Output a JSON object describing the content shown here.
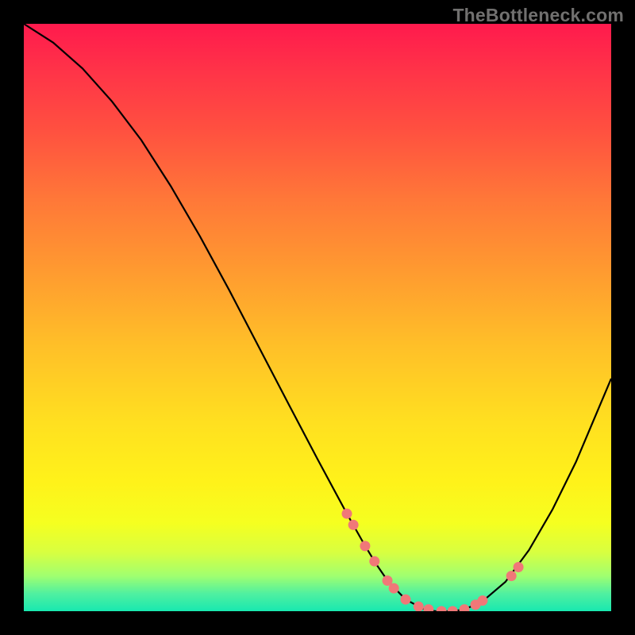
{
  "watermark": "TheBottleneck.com",
  "chart_data": {
    "type": "line",
    "title": "",
    "xlabel": "",
    "ylabel": "",
    "xlim": [
      0,
      100
    ],
    "ylim": [
      0,
      100
    ],
    "series": [
      {
        "name": "curve",
        "x": [
          0,
          5,
          10,
          15,
          20,
          25,
          30,
          35,
          40,
          45,
          50,
          55,
          58,
          60,
          62,
          65,
          68,
          70,
          73,
          75,
          78,
          82,
          86,
          90,
          94,
          100
        ],
        "y": [
          100,
          96.8,
          92.4,
          86.8,
          80.2,
          72.4,
          63.8,
          54.6,
          45.0,
          35.4,
          25.9,
          16.6,
          11.3,
          8.0,
          5.1,
          2.0,
          0.4,
          0.0,
          0.0,
          0.3,
          1.6,
          5.0,
          10.4,
          17.3,
          25.4,
          39.6
        ]
      }
    ],
    "markers": {
      "name": "points",
      "color": "#f07878",
      "radius_px": 6.5,
      "x": [
        55.0,
        56.1,
        58.1,
        59.7,
        61.9,
        63.0,
        65.0,
        67.2,
        68.9,
        71.1,
        73.0,
        75.0,
        76.9,
        78.1,
        83.0,
        84.2
      ],
      "y": [
        16.6,
        14.7,
        11.1,
        8.5,
        5.2,
        3.9,
        2.0,
        0.8,
        0.3,
        0.0,
        0.0,
        0.3,
        1.1,
        1.8,
        6.0,
        7.5
      ]
    }
  }
}
